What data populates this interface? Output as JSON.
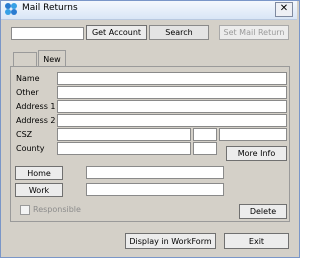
{
  "window": {
    "title": "Mail Returns"
  },
  "toolbar": {
    "search_value": "",
    "get_account": "Get Account",
    "search": "Search",
    "set_mail_return": "Set Mail Return"
  },
  "tabs": [
    {
      "label": ""
    },
    {
      "label": "New"
    }
  ],
  "form": {
    "name_label": "Name",
    "other_label": "Other",
    "address1_label": "Address 1",
    "address2_label": "Address 2",
    "csz_label": "CSZ",
    "county_label": "County",
    "more_info": "More Info",
    "home": "Home",
    "work": "Work",
    "responsible": "Responsible",
    "delete": "Delete"
  },
  "footer": {
    "display_workform": "Display in WorkForm",
    "exit": "Exit"
  }
}
